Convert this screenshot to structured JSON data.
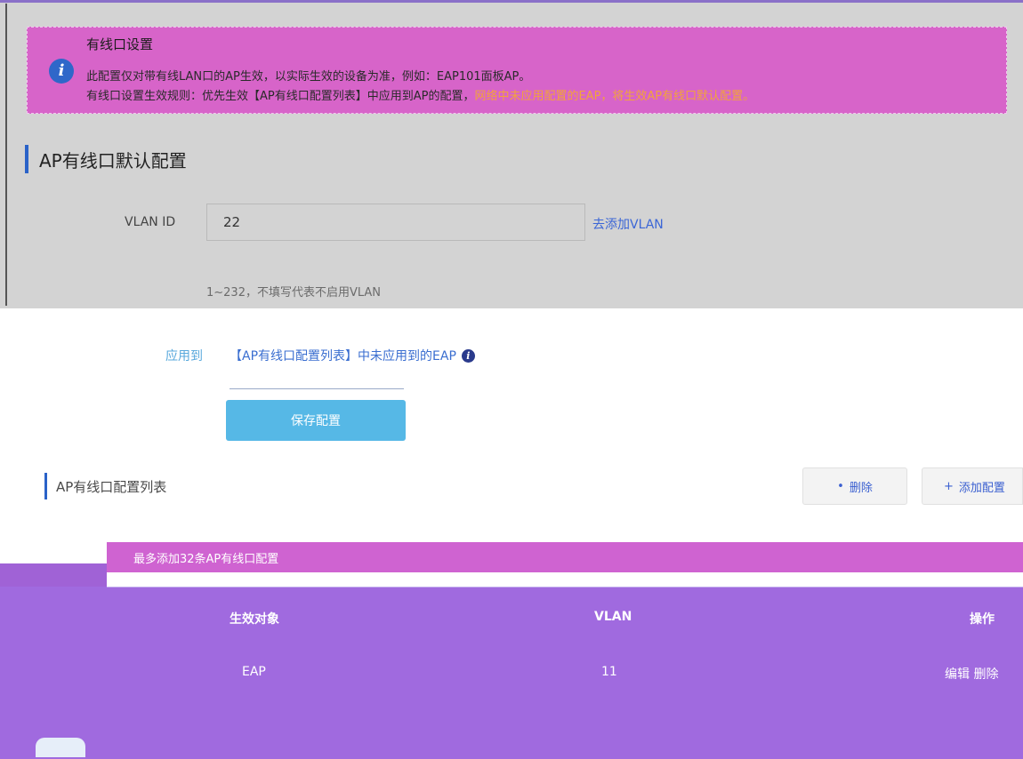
{
  "notice": {
    "title": "有线口设置",
    "line1": "此配置仅对带有线LAN口的AP生效，以实际生效的设备为准，例如：EAP101面板AP。",
    "line2_main": "有线口设置生效规则：优先生效【AP有线口配置列表】中应用到AP的配置，",
    "line2_highlight": "网络中未应用配置的EAP，将生效AP有线口默认配置。",
    "icon": "info-icon"
  },
  "default_section": {
    "title": "AP有线口默认配置",
    "vlan_label": "VLAN ID",
    "vlan_value": "22",
    "add_vlan_link": "去添加VLAN",
    "vlan_hint": "1~232，不填写代表不启用VLAN",
    "scope_label": "应用到",
    "scope_value": "【AP有线口配置列表】中未应用到的EAP",
    "save_button": "保存配置"
  },
  "list_section": {
    "title": "AP有线口配置列表",
    "delete_button": "删除",
    "add_button": "添加配置",
    "toolbar_text": "最多添加32条AP有线口配置"
  },
  "table": {
    "headers": [
      "生效对象",
      "VLAN",
      "操作"
    ],
    "row": [
      "EAP",
      "11",
      "编辑 删除"
    ]
  },
  "colors": {
    "accent": "#2a62c8",
    "button": "#56b8e6",
    "notice_bg": "#d764c9",
    "table_bg": "#a06adf"
  }
}
